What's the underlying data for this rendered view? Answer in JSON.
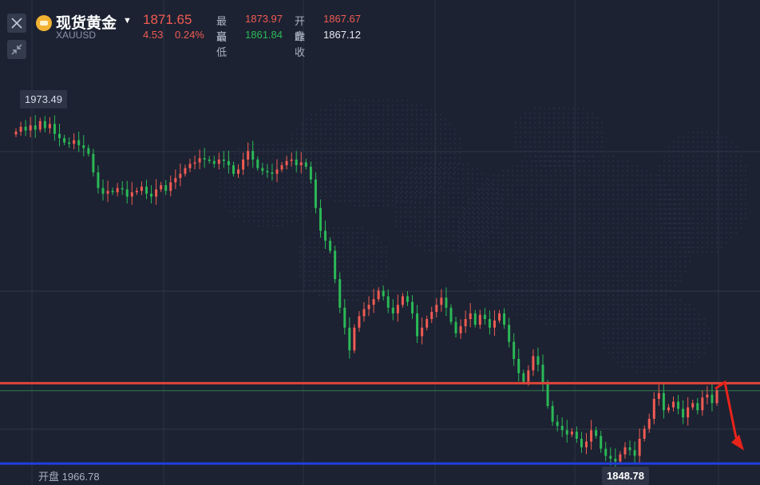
{
  "instrument": {
    "name": "现货黄金",
    "code": "XAUUSD",
    "price": "1871.65",
    "change": "4.53",
    "change_pct": "0.24%"
  },
  "stats": {
    "high_label": "最高",
    "high_value": "1873.97",
    "open_label": "开盘",
    "open_value": "1867.67",
    "low_label": "最低",
    "low_value": "1861.84",
    "prev_close_label": "昨收",
    "prev_close_value": "1867.12"
  },
  "markers": {
    "chart_high": "1973.49",
    "chart_low": "1848.78",
    "open_text": "开盘 1966.78"
  },
  "icons": {
    "close": "close-icon",
    "collapse": "collapse-arrows-icon",
    "logo": "gold-coin-icon",
    "dropdown": "caret-down-icon"
  },
  "colors": {
    "up": "#f05b52",
    "down": "#2bb856",
    "resistance": "#e0453a",
    "support": "#1f3fe0",
    "background": "#1c2232"
  },
  "chart_data": {
    "type": "candlestick",
    "ylim": [
      1845,
      1985
    ],
    "resistance_level": 1878.5,
    "support_level": 1850.3,
    "closes": [
      1966.8,
      1968.5,
      1967.2,
      1969.0,
      1967.5,
      1970.5,
      1968.0,
      1969.5,
      1966.0,
      1964.5,
      1963.0,
      1962.5,
      1963.8,
      1962.0,
      1961.0,
      1959.0,
      1952.5,
      1947.0,
      1945.0,
      1946.0,
      1945.5,
      1947.0,
      1946.5,
      1944.0,
      1945.5,
      1946.0,
      1947.5,
      1945.0,
      1944.0,
      1946.5,
      1948.0,
      1946.0,
      1949.0,
      1950.5,
      1952.0,
      1954.0,
      1955.5,
      1956.0,
      1957.5,
      1957.0,
      1956.5,
      1955.5,
      1957.0,
      1956.5,
      1955.0,
      1952.0,
      1953.5,
      1957.0,
      1960.0,
      1957.0,
      1954.0,
      1953.0,
      1952.5,
      1952.0,
      1953.5,
      1955.0,
      1956.5,
      1957.0,
      1955.0,
      1956.0,
      1954.5,
      1950.0,
      1940.0,
      1932.0,
      1928.5,
      1925.0,
      1915.0,
      1905.0,
      1898.0,
      1890.0,
      1898.0,
      1902.0,
      1904.5,
      1906.0,
      1908.0,
      1911.0,
      1909.0,
      1905.0,
      1903.0,
      1906.0,
      1909.0,
      1907.0,
      1903.0,
      1895.0,
      1898.0,
      1901.0,
      1903.5,
      1906.0,
      1908.5,
      1905.0,
      1900.0,
      1896.0,
      1898.5,
      1901.0,
      1903.0,
      1899.0,
      1902.5,
      1901.0,
      1898.0,
      1900.5,
      1903.0,
      1899.0,
      1893.0,
      1887.0,
      1882.0,
      1879.0,
      1883.0,
      1888.0,
      1885.0,
      1878.5,
      1870.5,
      1865.0,
      1863.5,
      1862.0,
      1860.5,
      1861.5,
      1859.0,
      1856.0,
      1858.0,
      1862.0,
      1860.0,
      1855.5,
      1853.0,
      1852.0,
      1851.0,
      1853.5,
      1856.0,
      1855.0,
      1853.0,
      1859.0,
      1862.5,
      1866.0,
      1873.0,
      1875.0,
      1869.0,
      1870.0,
      1872.0,
      1869.5,
      1866.5,
      1870.0,
      1871.5,
      1869.0,
      1873.5,
      1874.5,
      1871.5,
      1876.0
    ],
    "projection": {
      "direction": "down",
      "to": 1856.0
    }
  }
}
